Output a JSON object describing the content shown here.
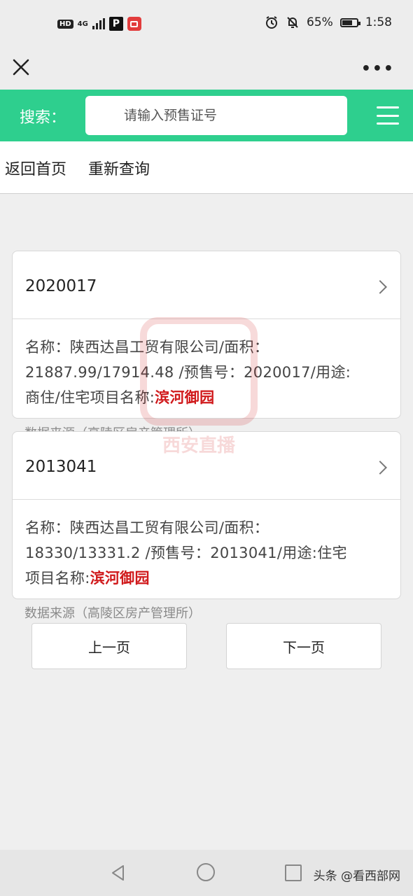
{
  "status": {
    "hd": "HD",
    "signal": "4G",
    "battery": "65%",
    "battery_level": 0.65,
    "time": "1:58"
  },
  "search": {
    "label": "搜索：",
    "placeholder": "请输入预售证号"
  },
  "nav": {
    "home": "返回首页",
    "requery": "重新查询"
  },
  "results": [
    {
      "number": "2020017",
      "name_label": "名称：",
      "company": "陕西达昌工贸有限公司",
      "area_label": "/面积：",
      "area": "21887.99/17914.48",
      "presale_label": " /预售号：",
      "presale": "2020017",
      "usage_label": "/用途:",
      "usage": "商住",
      "project_label": "/住宅项目名称:",
      "project": "滨河御园",
      "source": "数据来源（高陵区房产管理所）"
    },
    {
      "number": "2013041",
      "name_label": "名称：",
      "company": "陕西达昌工贸有限公司",
      "area_label": "/面积：",
      "area": "18330/13331.2",
      "presale_label": " /预售号：",
      "presale": "2013041",
      "usage_label": "/用途:",
      "usage": "住宅",
      "project_label": "项目名称:",
      "project": "滨河御园",
      "source": "数据来源（高陵区房产管理所）"
    }
  ],
  "pagination": {
    "prev": "上一页",
    "next": "下一页"
  },
  "watermark": {
    "text": "西安直播"
  },
  "credit": "头条 @看西部网",
  "colors": {
    "accent": "#2ecf8e",
    "highlight": "#d0191b"
  }
}
